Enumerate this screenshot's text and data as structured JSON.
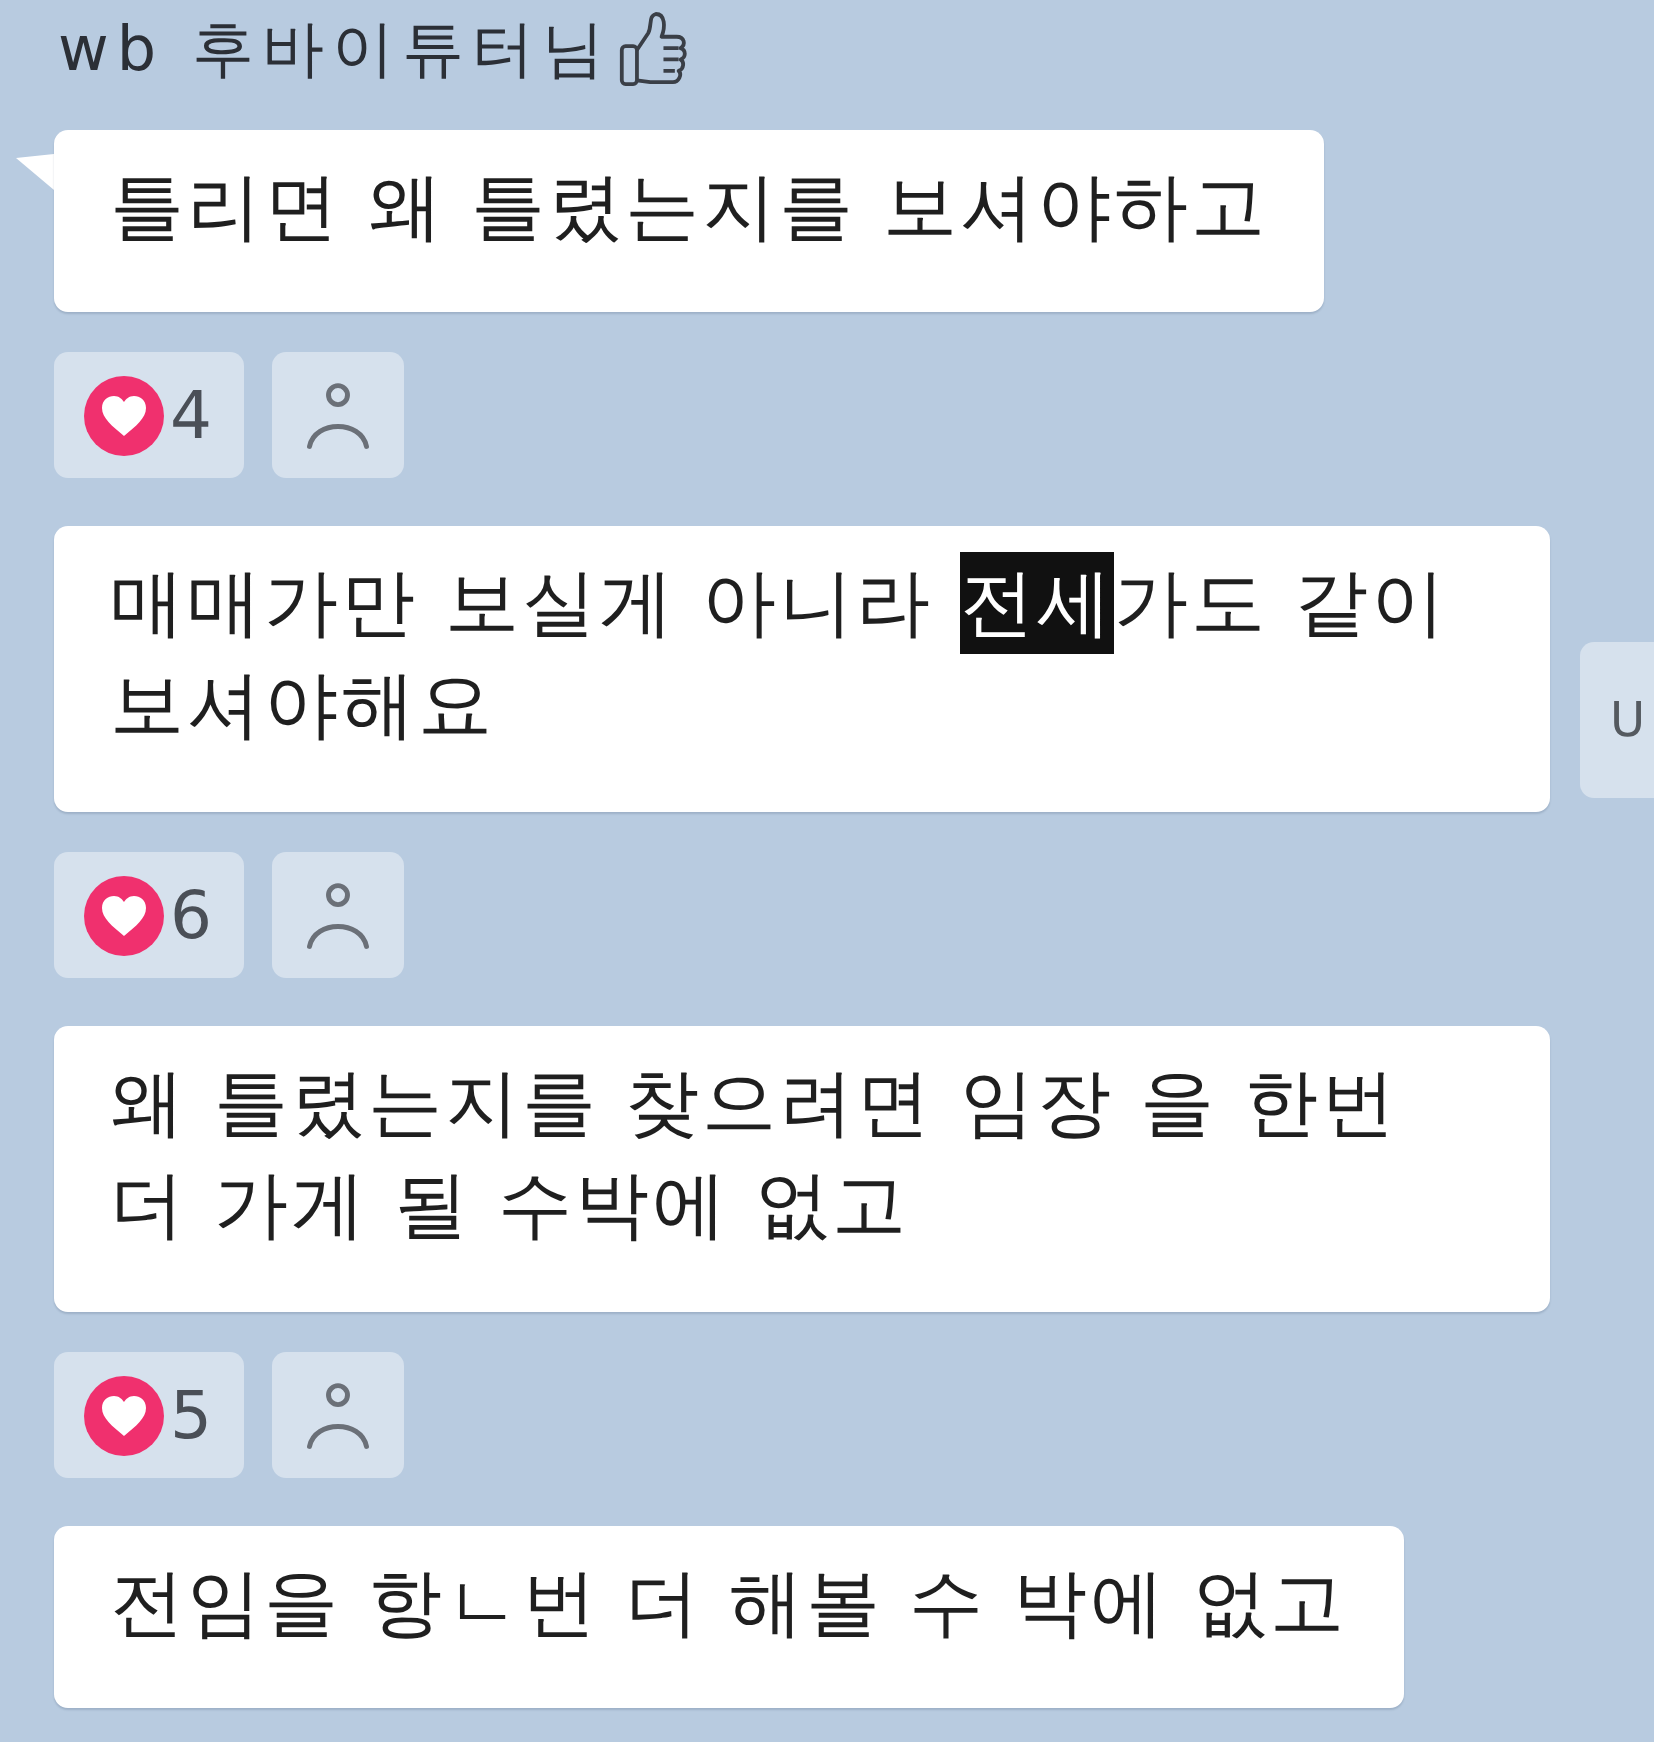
{
  "sender": {
    "name": "wb 후바이튜터님"
  },
  "messages": [
    {
      "tail": true,
      "lines": [
        [
          {
            "text": "틀리면 왜 틀렸는지를 보셔야하고",
            "selected": false
          }
        ]
      ],
      "reactions": [
        {
          "kind": "like",
          "count": "4"
        },
        {
          "kind": "profile"
        }
      ]
    },
    {
      "tail": false,
      "lines": [
        [
          {
            "text": "매매가만 보실게 아니라 ",
            "selected": false
          },
          {
            "text": "전세",
            "selected": true
          },
          {
            "text": "가도 같이",
            "selected": false
          }
        ],
        [
          {
            "text": "보셔야해요",
            "selected": false
          }
        ]
      ],
      "side_button": {
        "text": "U"
      },
      "reactions": [
        {
          "kind": "like",
          "count": "6"
        },
        {
          "kind": "profile"
        }
      ]
    },
    {
      "tail": false,
      "lines": [
        [
          {
            "text": "왜 틀렸는지를 찾으려면 임장 을 한번",
            "selected": false
          }
        ],
        [
          {
            "text": "더 가게 될 수박에 없고",
            "selected": false
          }
        ]
      ],
      "reactions": [
        {
          "kind": "like",
          "count": "5"
        },
        {
          "kind": "profile"
        }
      ]
    },
    {
      "tail": false,
      "lines": [
        [
          {
            "text": "전임을 항ㄴ번 더 해볼 수 박에 없고",
            "selected": false
          }
        ]
      ]
    }
  ]
}
